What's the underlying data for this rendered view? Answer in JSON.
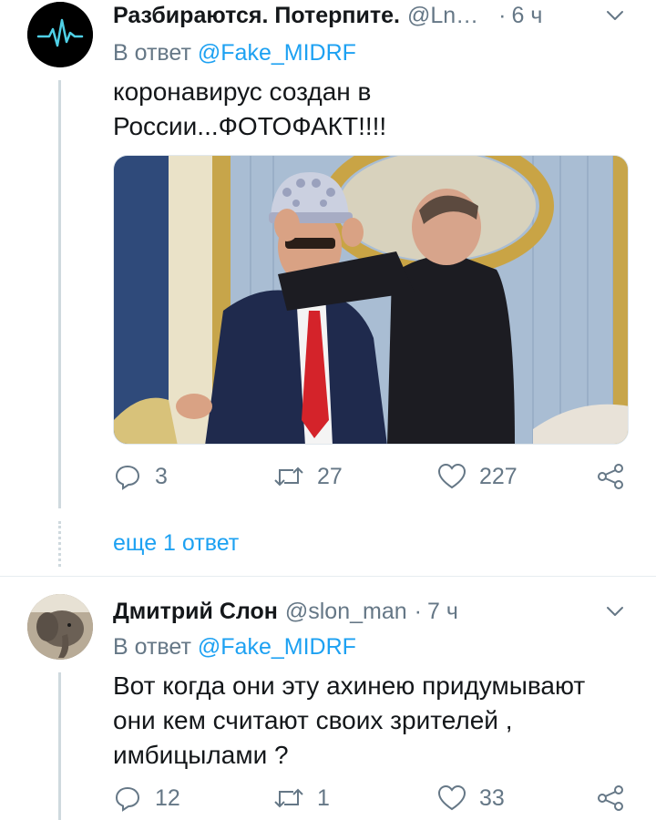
{
  "tweet1": {
    "name": "Разбираются. Потерпите.",
    "handle": "@Ln…",
    "dot": "·",
    "time": "6 ч",
    "reply_prefix": "В ответ",
    "reply_mention": "@Fake_MIDRF",
    "text_line1": "коронавирус создан в",
    "text_line2": "России...ФОТОФАКТ!!!!",
    "replies": "3",
    "retweets": "27",
    "likes": "227"
  },
  "more_replies": "еще 1 ответ",
  "tweet2": {
    "name": "Дмитрий Слон",
    "handle": "@slon_man",
    "dot": "·",
    "time": "7 ч",
    "reply_prefix": "В ответ",
    "reply_mention": "@Fake_MIDRF",
    "text_line1": "Вот когда они эту ахинею придумывают",
    "text_line2": "они кем считают своих зрителей ,",
    "text_line3": "имбицылами ?",
    "replies": "12",
    "retweets": "1",
    "likes": "33"
  },
  "colors": {
    "text_primary": "#14171a",
    "text_secondary": "#657786",
    "link": "#1da1f2",
    "line": "#cfd9de"
  },
  "icons": [
    "pulse-logo-icon",
    "chevron-down-icon",
    "reply-icon",
    "retweet-icon",
    "like-icon",
    "share-icon"
  ]
}
